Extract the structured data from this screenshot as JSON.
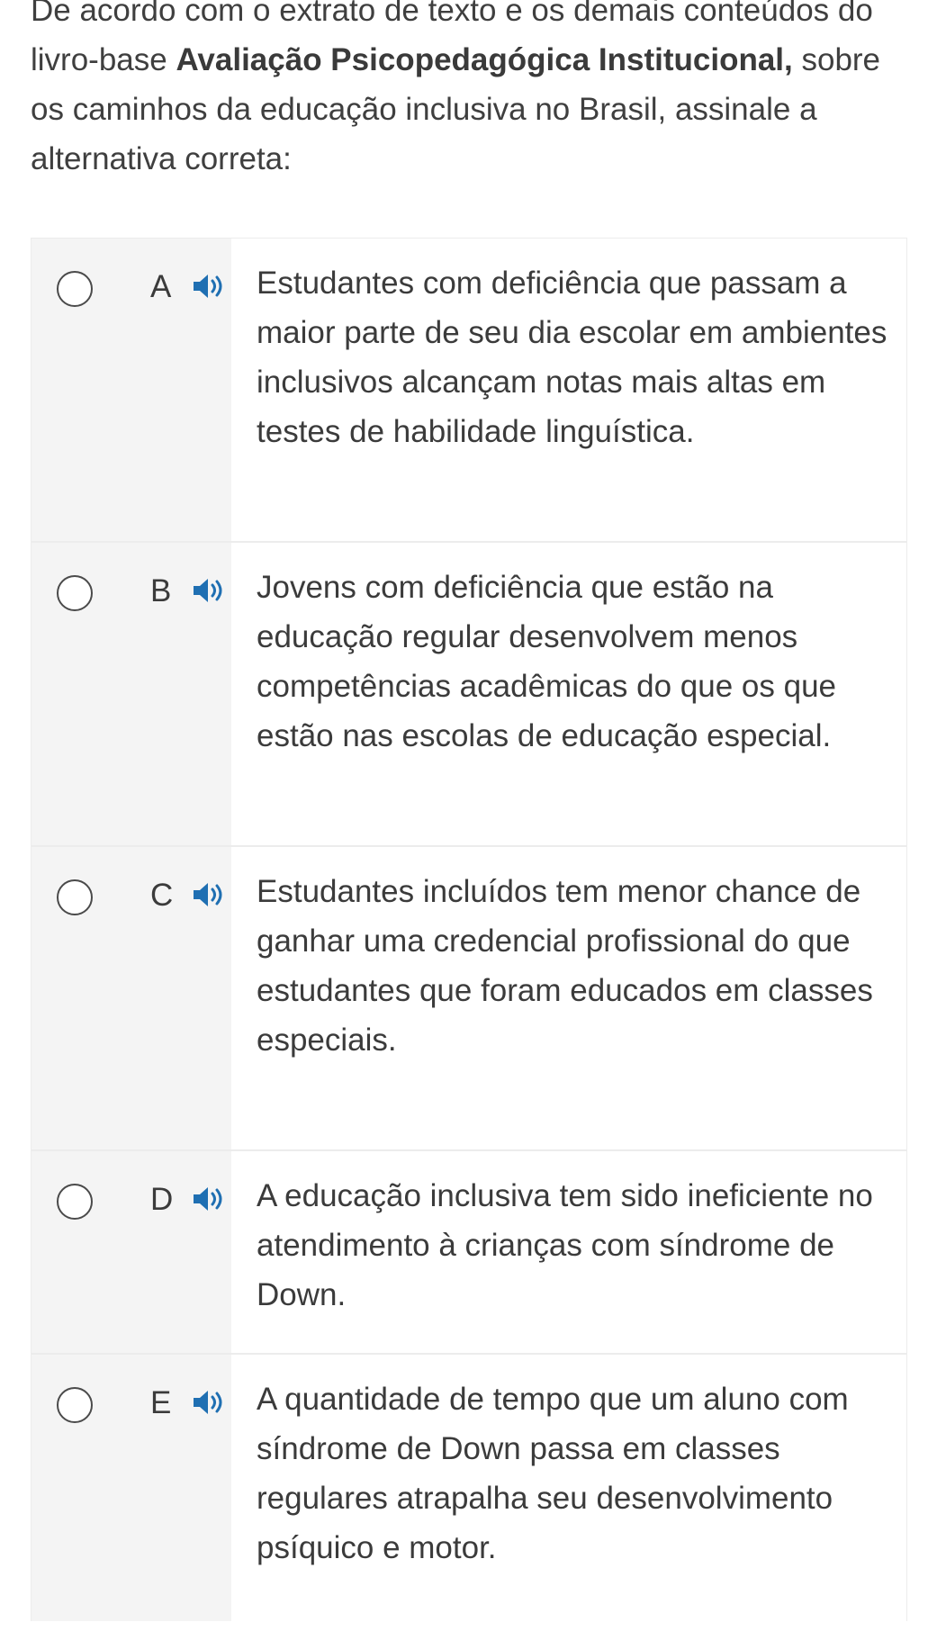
{
  "question": {
    "text_before": "De acordo com o extrato de texto e os demais conteúdos do livro-base ",
    "book_title": "Avaliação Psicopedagógica Institucional,",
    "text_after": " sobre os caminhos da educação inclusiva no Brasil, assinale a alternativa correta:"
  },
  "icons": {
    "radio": "radio-button-icon",
    "speaker": "speaker-icon"
  },
  "colors": {
    "speaker_blue": "#1f6fb2",
    "radio_border": "#4a4a4a",
    "option_gray_bg": "#f4f4f4"
  },
  "options": [
    {
      "letter": "A",
      "text": "Estudantes com deficiência que passam a maior parte de seu dia escolar em ambientes inclusivos alcançam notas mais altas em testes de habilidade linguística."
    },
    {
      "letter": "B",
      "text": "Jovens com deficiência que estão na educação regular desenvolvem menos competências acadêmicas do que os que estão nas escolas de educação especial."
    },
    {
      "letter": "C",
      "text": "Estudantes incluídos tem menor chance de ganhar uma credencial profissional do que estudantes que foram educados em classes especiais."
    },
    {
      "letter": "D",
      "text": "A educação inclusiva tem sido ineficiente no atendimento à crianças com síndrome de Down."
    },
    {
      "letter": "E",
      "text": "A quantidade de tempo que um aluno com síndrome de Down passa em classes regulares atrapalha seu desenvolvimento psíquico e motor."
    }
  ]
}
